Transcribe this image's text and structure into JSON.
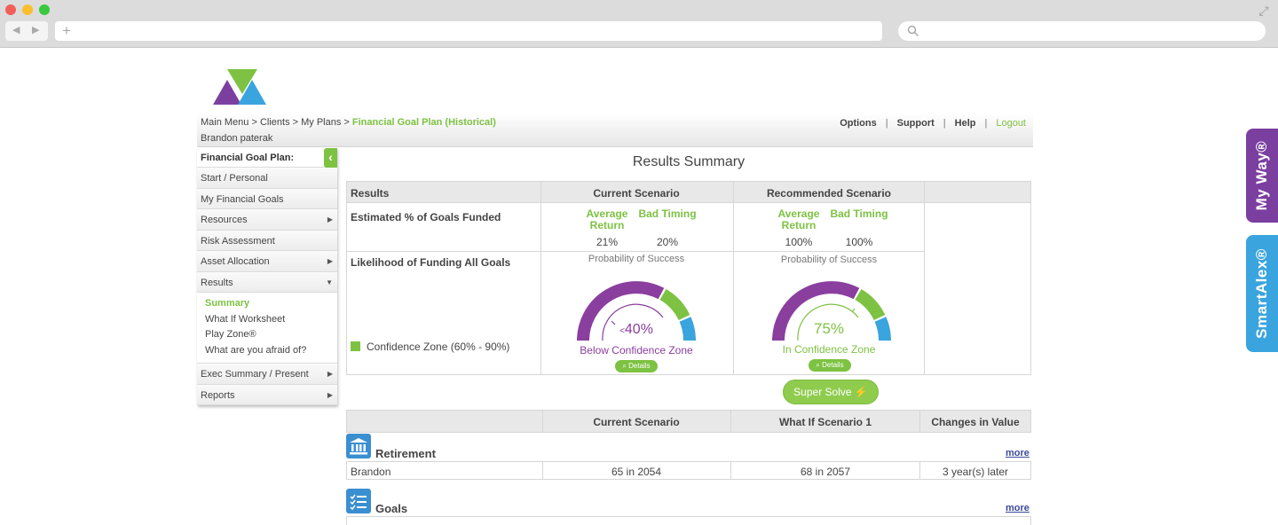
{
  "browser": {
    "icons": {
      "back": "triangle-left",
      "forward": "triangle-right",
      "new_tab": "plus",
      "search": "magnifier",
      "expand": "diagonal-arrows"
    }
  },
  "side_tabs": {
    "my_way": "My Way®",
    "smart_alex": "SmartAlex®"
  },
  "header": {
    "breadcrumb_prefix": "Main Menu > Clients > My Plans > ",
    "breadcrumb_current": "Financial Goal Plan (Historical)",
    "client_name": "Brandon paterak",
    "nav": {
      "options": "Options",
      "support": "Support",
      "help": "Help",
      "logout": "Logout",
      "separator": "|"
    }
  },
  "sidebar": {
    "title": "Financial Goal Plan:",
    "toggle_glyph": "‹",
    "items": [
      {
        "label": "Start / Personal",
        "arrow": ""
      },
      {
        "label": "My Financial Goals",
        "arrow": ""
      },
      {
        "label": "Resources",
        "arrow": "▶"
      },
      {
        "label": "Risk Assessment",
        "arrow": ""
      },
      {
        "label": "Asset Allocation",
        "arrow": "▶"
      },
      {
        "label": "Results",
        "arrow": "▼"
      }
    ],
    "sub_items": [
      "Summary",
      "What If Worksheet",
      "Play Zone®",
      "What are you afraid of?"
    ],
    "bottom_items": [
      {
        "label": "Exec Summary / Present",
        "arrow": "▶"
      },
      {
        "label": "Reports",
        "arrow": "▶"
      }
    ]
  },
  "main": {
    "title": "Results Summary",
    "results_table": {
      "headers": [
        "Results",
        "Current Scenario",
        "Recommended Scenario"
      ],
      "row1_label": "Estimated % of Goals Funded",
      "row2_label": "Likelihood of Funding All Goals",
      "metric_avg": "Average Return",
      "metric_bad": "Bad Timing",
      "current": {
        "avg": "21%",
        "bad": "20%"
      },
      "recommended": {
        "avg": "100%",
        "bad": "100%"
      },
      "prob_label": "Probability of Success",
      "legend": "Confidence Zone (60% - 90%)",
      "current_gauge": {
        "prefix": "<",
        "value": "40%",
        "label": "Below Confidence Zone",
        "color": "#8a3f9e"
      },
      "recommended_gauge": {
        "prefix": "",
        "value": "75%",
        "label": "In Confidence Zone",
        "color": "#7dc242"
      },
      "details": "Details"
    },
    "super_solve": "Super Solve ⚡",
    "compare_table": {
      "headers": [
        "Current Scenario",
        "What If Scenario 1",
        "Changes in Value"
      ],
      "sections": [
        {
          "title": "Retirement",
          "more": "more",
          "icon": "bank-icon"
        },
        {
          "title": "Goals",
          "more": "more",
          "icon": "checklist-icon"
        }
      ],
      "row": {
        "name": "Brandon",
        "current": "65 in 2054",
        "whatif": "68 in 2057",
        "change": "3 year(s) later"
      }
    }
  },
  "colors": {
    "brand_green": "#7dc242",
    "brand_purple": "#7b3fa0",
    "brand_blue": "#3aa4de"
  }
}
